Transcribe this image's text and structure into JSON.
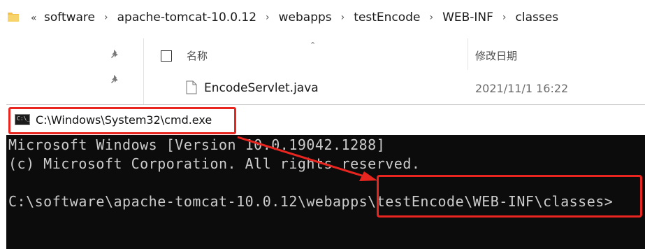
{
  "explorer": {
    "breadcrumb_overflow": "«",
    "breadcrumbs": [
      "software",
      "apache-tomcat-10.0.12",
      "webapps",
      "testEncode",
      "WEB-INF",
      "classes"
    ],
    "columns": {
      "name": "名称",
      "date_modified": "修改日期"
    },
    "files": [
      {
        "name": "EncodeServlet.java",
        "date": "2021/11/1 16:22"
      }
    ]
  },
  "cmd": {
    "title": "C:\\Windows\\System32\\cmd.exe",
    "icon_label": "C:\\_",
    "lines": [
      "Microsoft Windows [Version 10.0.19042.1288]",
      "(c) Microsoft Corporation. All rights reserved.",
      "",
      "C:\\software\\apache-tomcat-10.0.12\\webapps\\testEncode\\WEB-INF\\classes>"
    ]
  },
  "icons": {
    "folder": "folder-icon",
    "pin": "pin-icon",
    "file": "java-file-icon",
    "chevron": "chevron-right-icon",
    "sort": "sort-ascending-icon"
  },
  "colors": {
    "highlight": "#e8251f",
    "console_bg": "#0c0c0c",
    "console_text": "#cccccc",
    "folder": "#f2c14e"
  }
}
